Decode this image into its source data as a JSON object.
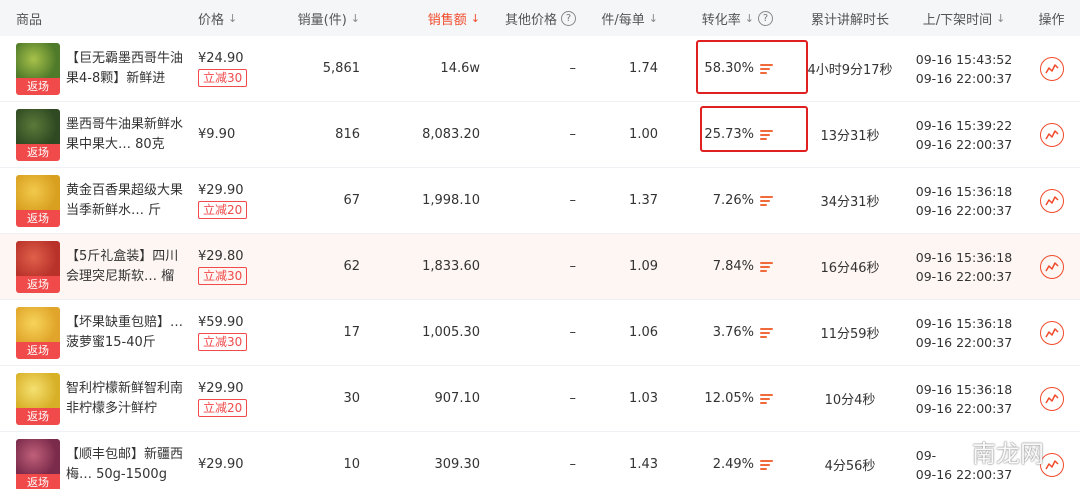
{
  "header": {
    "product": "商品",
    "price": "价格",
    "sales_qty": "销量(件)",
    "sales_amount": "销售额",
    "other_price": "其他价格",
    "units_per_order": "件/每单",
    "conversion": "转化率",
    "explain_duration": "累计讲解时长",
    "shelf_time": "上/下架时间",
    "action": "操作",
    "sort_icon": "↓",
    "help_icon": "?"
  },
  "colors": {
    "accent": "#f04a2a",
    "tag": "#f04a4a",
    "highlight_row": "#fdf6f3",
    "annotation_box": "#e02020"
  },
  "rows": [
    {
      "name": "【巨无霸墨西哥牛油果4-8颗】新鲜进",
      "tag": "返场",
      "price": "¥24.90",
      "coupon": "立减30",
      "sales_qty": "5,861",
      "sales_amount": "14.6w",
      "other_price": "–",
      "units": "1.74",
      "conversion": "58.30%",
      "duration": "4小时9分17秒",
      "up": "09-16  15:43:52",
      "down": "09-16  22:00:37"
    },
    {
      "name": "墨西哥牛油果新鲜水果中果大… 80克",
      "tag": "返场",
      "price": "¥9.90",
      "coupon": "",
      "sales_qty": "816",
      "sales_amount": "8,083.20",
      "other_price": "–",
      "units": "1.00",
      "conversion": "25.73%",
      "duration": "13分31秒",
      "up": "09-16  15:39:22",
      "down": "09-16  22:00:37"
    },
    {
      "name": "黄金百香果超级大果当季新鲜水… 斤",
      "tag": "返场",
      "price": "¥29.90",
      "coupon": "立减20",
      "sales_qty": "67",
      "sales_amount": "1,998.10",
      "other_price": "–",
      "units": "1.37",
      "conversion": "7.26%",
      "duration": "34分31秒",
      "up": "09-16  15:36:18",
      "down": "09-16  22:00:37"
    },
    {
      "name": "【5斤礼盒装】四川会理突尼斯软… 榴",
      "tag": "返场",
      "price": "¥29.80",
      "coupon": "立减30",
      "sales_qty": "62",
      "sales_amount": "1,833.60",
      "other_price": "–",
      "units": "1.09",
      "conversion": "7.84%",
      "duration": "16分46秒",
      "up": "09-16  15:36:18",
      "down": "09-16  22:00:37"
    },
    {
      "name": "【坏果缺重包赔】… 菠萝蜜15-40斤",
      "tag": "返场",
      "price": "¥59.90",
      "coupon": "立减30",
      "sales_qty": "17",
      "sales_amount": "1,005.30",
      "other_price": "–",
      "units": "1.06",
      "conversion": "3.76%",
      "duration": "11分59秒",
      "up": "09-16  15:36:18",
      "down": "09-16  22:00:37"
    },
    {
      "name": "智利柠檬新鲜智利南非柠檬多汁鲜柠",
      "tag": "返场",
      "price": "¥29.90",
      "coupon": "立减20",
      "sales_qty": "30",
      "sales_amount": "907.10",
      "other_price": "–",
      "units": "1.03",
      "conversion": "12.05%",
      "duration": "10分4秒",
      "up": "09-16  15:36:18",
      "down": "09-16  22:00:37"
    },
    {
      "name": "【顺丰包邮】新疆西梅… 50g-1500g",
      "tag": "返场",
      "price": "¥29.90",
      "coupon": "",
      "sales_qty": "10",
      "sales_amount": "309.30",
      "other_price": "–",
      "units": "1.43",
      "conversion": "2.49%",
      "duration": "4分56秒",
      "up": "09-",
      "down": "09-16  22:00:37"
    }
  ],
  "watermark": "南龙网"
}
